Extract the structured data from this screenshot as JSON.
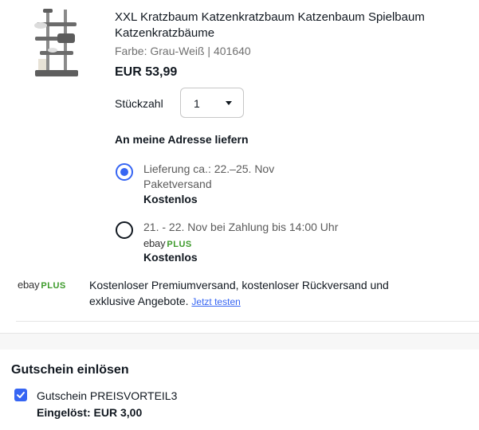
{
  "product": {
    "image_name": "cat-tree-product-image",
    "title": "XXL Kratzbaum Katzenkratzbaum Katzenbaum Spielbaum Katzenkratzbäume",
    "variant": "Farbe: Grau-Weiß | 401640",
    "price": "EUR 53,99"
  },
  "quantity": {
    "label": "Stückzahl",
    "value": "1"
  },
  "shipping": {
    "heading": "An meine Adresse liefern",
    "options": [
      {
        "line1": "Lieferung ca.: 22.–25. Nov",
        "line2": "Paketversand",
        "price": "Kostenlos",
        "selected": true
      },
      {
        "line1": "21. - 22. Nov bei Zahlung bis 14:00 Uhr",
        "logo_ebay": "ebay",
        "logo_plus": "PLUS",
        "price": "Kostenlos",
        "selected": false
      }
    ]
  },
  "ebay_plus_promo": {
    "logo_ebay": "ebay",
    "logo_plus": "PLUS",
    "text": "Kostenloser Premiumversand, kostenloser Rückversand und exklusive Angebote.",
    "link": "Jetzt testen"
  },
  "coupon": {
    "heading": "Gutschein einlösen",
    "name": "Gutschein PREISVORTEIL3",
    "redeemed": "Eingelöst: EUR 3,00",
    "checked": true
  },
  "colors": {
    "accent": "#3665f3",
    "plus_green": "#3c9a2a"
  }
}
